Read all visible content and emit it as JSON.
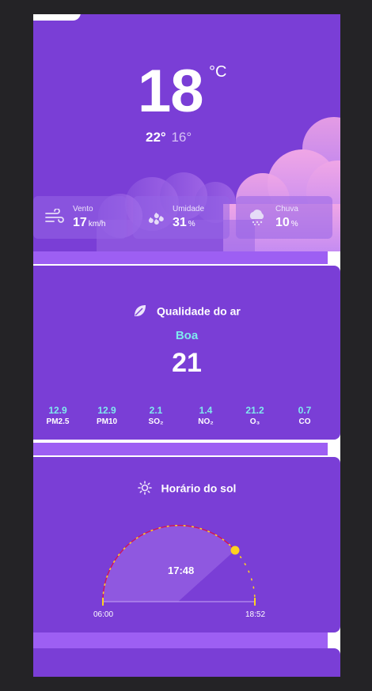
{
  "current": {
    "temperature": "18",
    "unit": "°C",
    "high": "22°",
    "low": "16°"
  },
  "stats": [
    {
      "label": "Vento",
      "value": "17",
      "unit": "km/h",
      "icon": "wind-icon"
    },
    {
      "label": "Umidade",
      "value": "31",
      "unit": "%",
      "icon": "humidity-icon"
    },
    {
      "label": "Chuva",
      "value": "10",
      "unit": "%",
      "icon": "rain-cloud-icon"
    }
  ],
  "air_quality": {
    "title": "Qualidade do ar",
    "status": "Boa",
    "index": "21",
    "pollutants": [
      {
        "value": "12.9",
        "name": "PM2.5"
      },
      {
        "value": "12.9",
        "name": "PM10"
      },
      {
        "value": "2.1",
        "name": "SO₂"
      },
      {
        "value": "1.4",
        "name": "NO₂"
      },
      {
        "value": "21.2",
        "name": "O₃"
      },
      {
        "value": "0.7",
        "name": "CO"
      }
    ]
  },
  "sun": {
    "title": "Horário do sol",
    "sunrise": "06:00",
    "sunset": "18:52",
    "current_time": "17:48"
  },
  "colors": {
    "background": "#7a3ed6",
    "accent": "#7fe9ee",
    "separator": "#9d5ff3",
    "sun": "#ffd21f"
  }
}
